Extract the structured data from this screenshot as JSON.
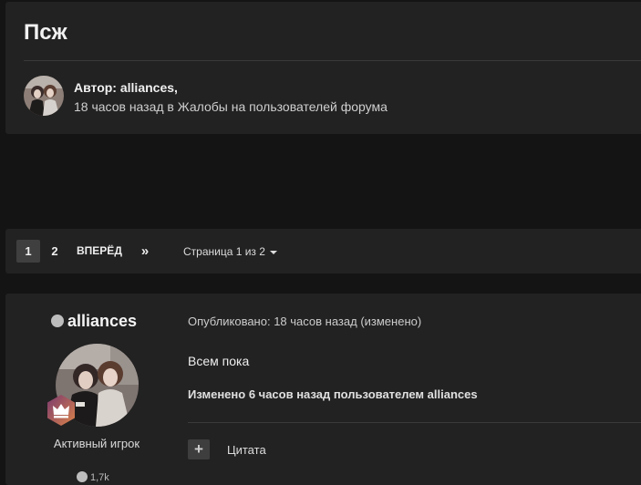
{
  "topic": {
    "title": "Псж",
    "author_line": "Автор: alliances,",
    "meta_line": "18 часов назад в Жалобы на пользователей форума"
  },
  "pagination": {
    "pages": [
      "1",
      "2"
    ],
    "current": "1",
    "next_label": "ВПЕРЁД",
    "last_label": "»",
    "page_of": "Страница 1 из 2"
  },
  "post": {
    "author": "alliances",
    "rank": "Активный игрок",
    "reputation": "1,7k",
    "published": "Опубликовано: 18 часов назад (изменено)",
    "body": "Всем пока",
    "edited_note": "Изменено 6 часов назад пользователем alliances",
    "quote_label": "Цитата",
    "quote_icon": "+"
  },
  "colors": {
    "background": "#141414",
    "panel": "#222222",
    "active_page": "#3f3f3f",
    "badge_gradient": [
      "#7b3a6e",
      "#d9824a"
    ]
  },
  "icons": [
    "plus-icon",
    "crown-icon",
    "chevron-double-right-icon",
    "caret-down-icon"
  ]
}
